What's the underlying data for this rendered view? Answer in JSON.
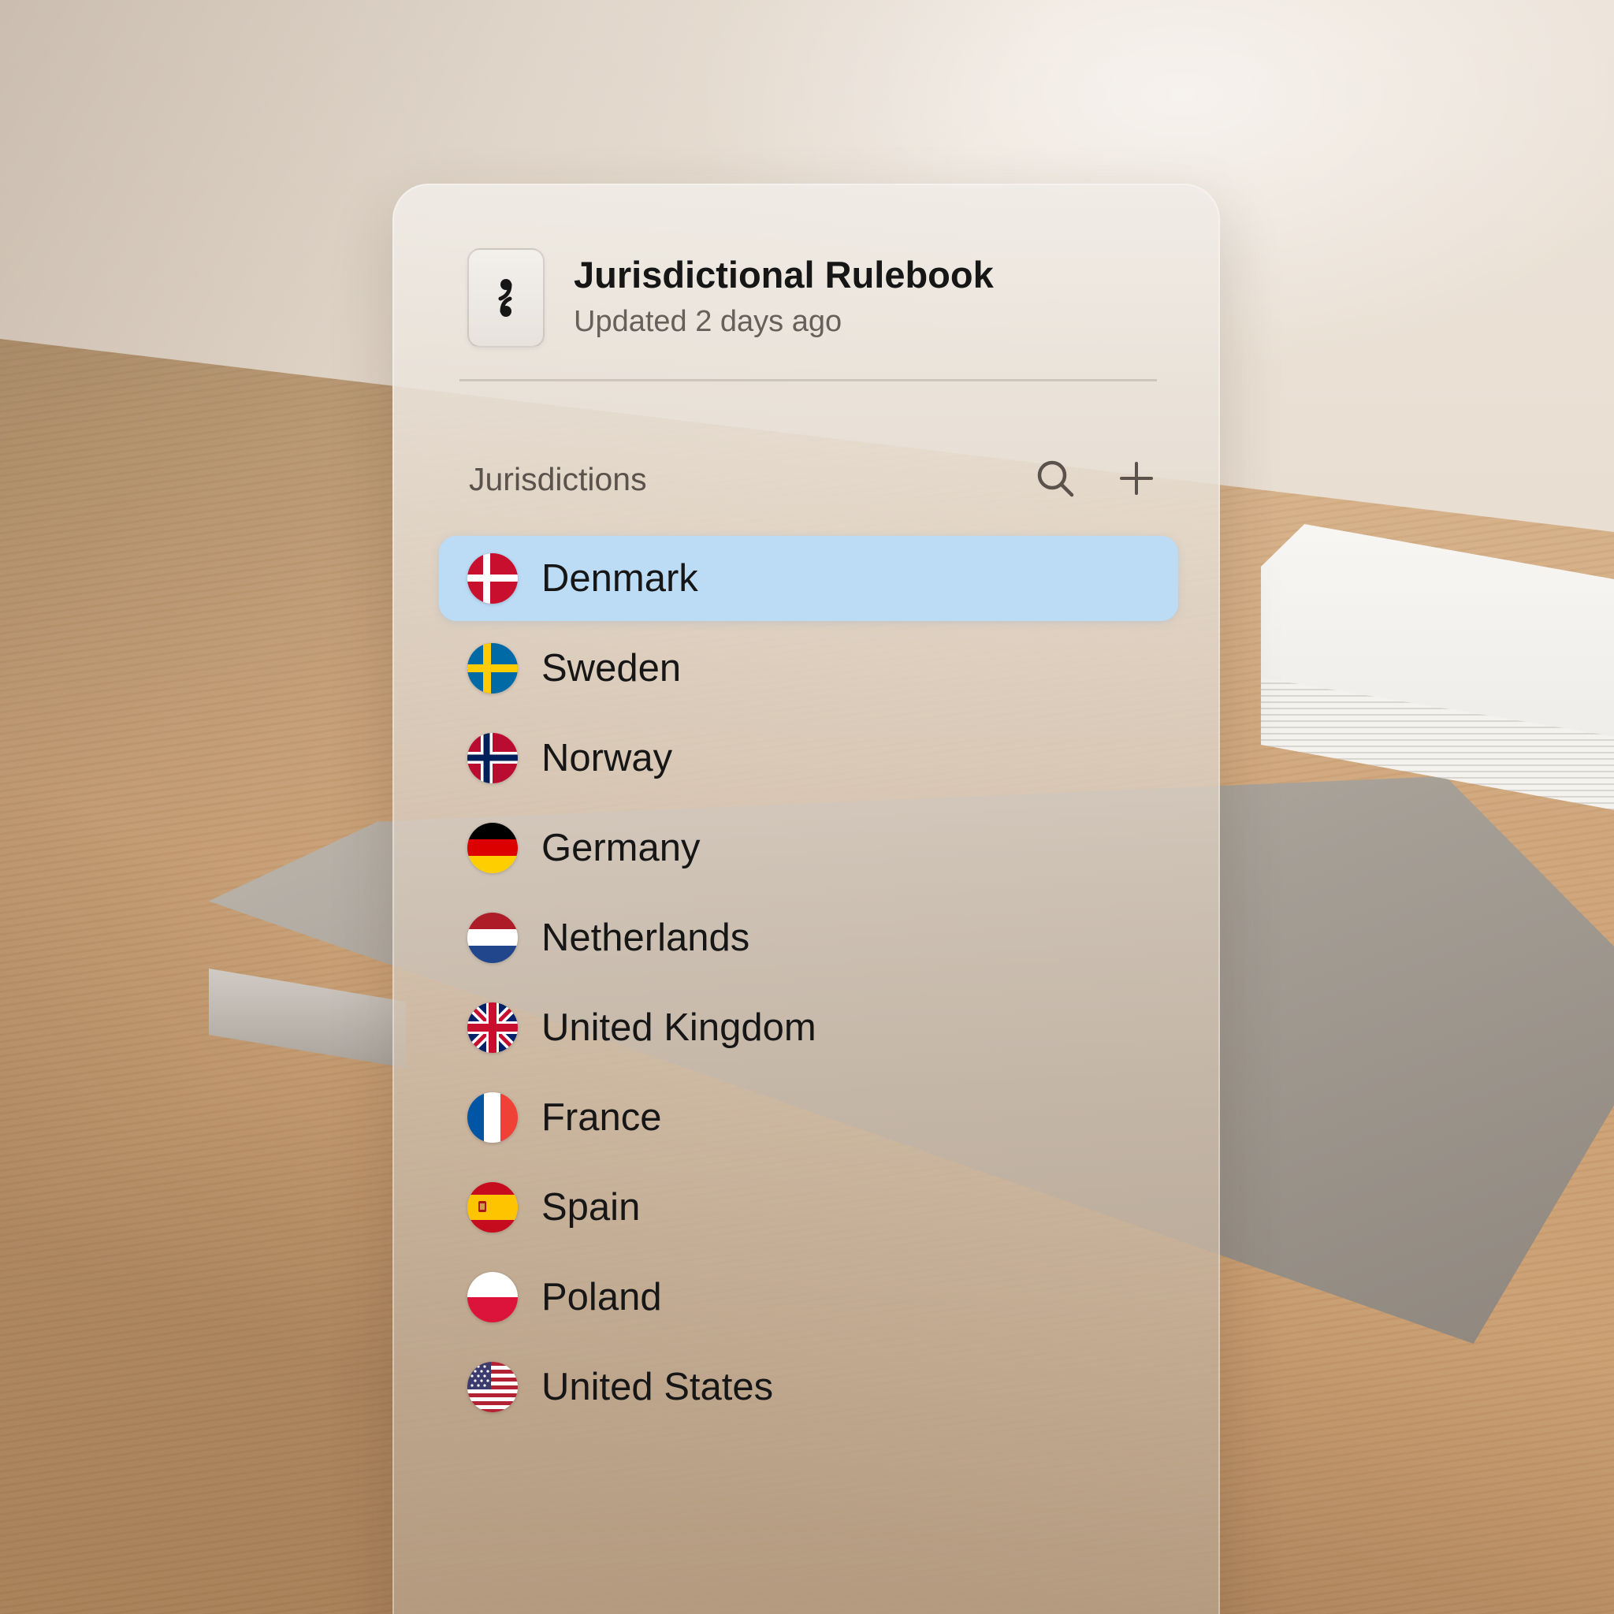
{
  "header": {
    "title": "Jurisdictional Rulebook",
    "subtitle": "Updated 2 days ago",
    "app_icon": "semicolon-icon"
  },
  "section": {
    "title": "Jurisdictions",
    "search_icon": "search-icon",
    "add_icon": "plus-icon"
  },
  "jurisdictions": [
    {
      "label": "Denmark",
      "flag": "denmark-flag-icon",
      "selected": true
    },
    {
      "label": "Sweden",
      "flag": "sweden-flag-icon",
      "selected": false
    },
    {
      "label": "Norway",
      "flag": "norway-flag-icon",
      "selected": false
    },
    {
      "label": "Germany",
      "flag": "germany-flag-icon",
      "selected": false
    },
    {
      "label": "Netherlands",
      "flag": "netherlands-flag-icon",
      "selected": false
    },
    {
      "label": "United Kingdom",
      "flag": "uk-flag-icon",
      "selected": false
    },
    {
      "label": "France",
      "flag": "france-flag-icon",
      "selected": false
    },
    {
      "label": "Spain",
      "flag": "spain-flag-icon",
      "selected": false
    },
    {
      "label": "Poland",
      "flag": "poland-flag-icon",
      "selected": false
    },
    {
      "label": "United States",
      "flag": "usa-flag-icon",
      "selected": false
    }
  ],
  "colors": {
    "selected_bg": "#bcdcf6",
    "text_primary": "#161616",
    "text_secondary": "#66605a"
  }
}
